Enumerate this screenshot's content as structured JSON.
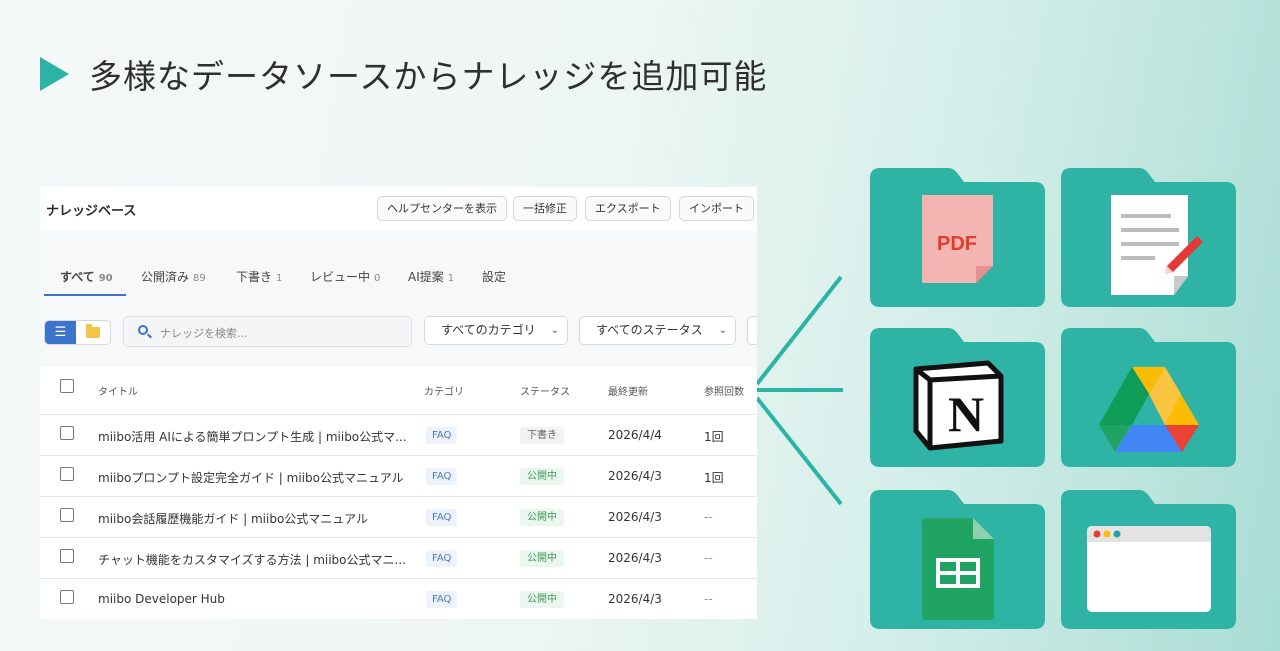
{
  "heading": {
    "title": "多様なデータソースからナレッジを追加可能"
  },
  "panel": {
    "title": "ナレッジベース",
    "buttons": [
      "ヘルプセンターを表示",
      "一括修正",
      "エクスポート",
      "インポート"
    ],
    "tabs": [
      {
        "label": "すべて",
        "count": "90"
      },
      {
        "label": "公開済み",
        "count": "89"
      },
      {
        "label": "下書き",
        "count": "1"
      },
      {
        "label": "レビュー中",
        "count": "0"
      },
      {
        "label": "AI提案",
        "count": "1"
      },
      {
        "label": "設定",
        "count": ""
      }
    ],
    "search_placeholder": "ナレッジを検索...",
    "category_select": "すべてのカテゴリ",
    "status_select": "すべてのステータス",
    "columns": {
      "title": "タイトル",
      "category": "カテゴリ",
      "status": "ステータス",
      "updated": "最終更新",
      "refs": "参照回数"
    },
    "rows": [
      {
        "title": "miibo活用 AIによる簡単プロンプト生成 | miibo公式マ...",
        "category": "FAQ",
        "status": "下書き",
        "updated": "2026/4/4",
        "refs": "1回"
      },
      {
        "title": "miiboプロンプト設定完全ガイド | miibo公式マニュアル",
        "category": "FAQ",
        "status": "公開中",
        "updated": "2026/4/3",
        "refs": "1回"
      },
      {
        "title": "miibo会話履歴機能ガイド | miibo公式マニュアル",
        "category": "FAQ",
        "status": "公開中",
        "updated": "2026/4/3",
        "refs": "--"
      },
      {
        "title": "チャット機能をカスタマイズする方法 | miibo公式マニ...",
        "category": "FAQ",
        "status": "公開中",
        "updated": "2026/4/3",
        "refs": "--"
      },
      {
        "title": "miibo Developer Hub",
        "category": "FAQ",
        "status": "公開中",
        "updated": "2026/4/3",
        "refs": "--"
      }
    ]
  },
  "sources": {
    "pdf_label": "PDF",
    "icons": [
      "pdf-document-icon",
      "text-document-edit-icon",
      "notion-logo-icon",
      "google-drive-logo-icon",
      "google-sheets-icon",
      "web-browser-window-icon"
    ]
  },
  "colors": {
    "accent": "#2bb3a6",
    "folder": "#2fb3a5",
    "tab_active": "#3b73c9",
    "published": "#3f9a5c"
  }
}
